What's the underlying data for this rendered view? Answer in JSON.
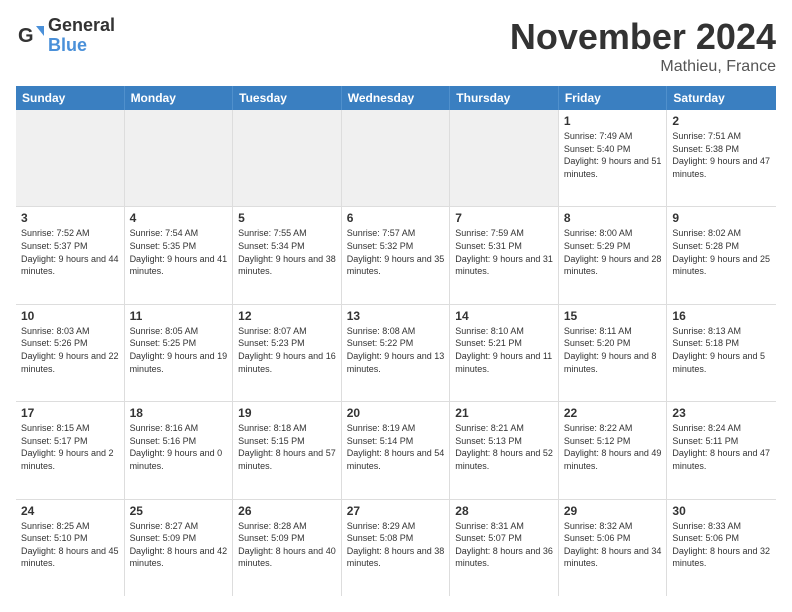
{
  "logo": {
    "general": "General",
    "blue": "Blue"
  },
  "title": "November 2024",
  "location": "Mathieu, France",
  "days_of_week": [
    "Sunday",
    "Monday",
    "Tuesday",
    "Wednesday",
    "Thursday",
    "Friday",
    "Saturday"
  ],
  "weeks": [
    [
      {
        "day": "",
        "info": ""
      },
      {
        "day": "",
        "info": ""
      },
      {
        "day": "",
        "info": ""
      },
      {
        "day": "",
        "info": ""
      },
      {
        "day": "",
        "info": ""
      },
      {
        "day": "1",
        "info": "Sunrise: 7:49 AM\nSunset: 5:40 PM\nDaylight: 9 hours and 51 minutes."
      },
      {
        "day": "2",
        "info": "Sunrise: 7:51 AM\nSunset: 5:38 PM\nDaylight: 9 hours and 47 minutes."
      }
    ],
    [
      {
        "day": "3",
        "info": "Sunrise: 7:52 AM\nSunset: 5:37 PM\nDaylight: 9 hours and 44 minutes."
      },
      {
        "day": "4",
        "info": "Sunrise: 7:54 AM\nSunset: 5:35 PM\nDaylight: 9 hours and 41 minutes."
      },
      {
        "day": "5",
        "info": "Sunrise: 7:55 AM\nSunset: 5:34 PM\nDaylight: 9 hours and 38 minutes."
      },
      {
        "day": "6",
        "info": "Sunrise: 7:57 AM\nSunset: 5:32 PM\nDaylight: 9 hours and 35 minutes."
      },
      {
        "day": "7",
        "info": "Sunrise: 7:59 AM\nSunset: 5:31 PM\nDaylight: 9 hours and 31 minutes."
      },
      {
        "day": "8",
        "info": "Sunrise: 8:00 AM\nSunset: 5:29 PM\nDaylight: 9 hours and 28 minutes."
      },
      {
        "day": "9",
        "info": "Sunrise: 8:02 AM\nSunset: 5:28 PM\nDaylight: 9 hours and 25 minutes."
      }
    ],
    [
      {
        "day": "10",
        "info": "Sunrise: 8:03 AM\nSunset: 5:26 PM\nDaylight: 9 hours and 22 minutes."
      },
      {
        "day": "11",
        "info": "Sunrise: 8:05 AM\nSunset: 5:25 PM\nDaylight: 9 hours and 19 minutes."
      },
      {
        "day": "12",
        "info": "Sunrise: 8:07 AM\nSunset: 5:23 PM\nDaylight: 9 hours and 16 minutes."
      },
      {
        "day": "13",
        "info": "Sunrise: 8:08 AM\nSunset: 5:22 PM\nDaylight: 9 hours and 13 minutes."
      },
      {
        "day": "14",
        "info": "Sunrise: 8:10 AM\nSunset: 5:21 PM\nDaylight: 9 hours and 11 minutes."
      },
      {
        "day": "15",
        "info": "Sunrise: 8:11 AM\nSunset: 5:20 PM\nDaylight: 9 hours and 8 minutes."
      },
      {
        "day": "16",
        "info": "Sunrise: 8:13 AM\nSunset: 5:18 PM\nDaylight: 9 hours and 5 minutes."
      }
    ],
    [
      {
        "day": "17",
        "info": "Sunrise: 8:15 AM\nSunset: 5:17 PM\nDaylight: 9 hours and 2 minutes."
      },
      {
        "day": "18",
        "info": "Sunrise: 8:16 AM\nSunset: 5:16 PM\nDaylight: 9 hours and 0 minutes."
      },
      {
        "day": "19",
        "info": "Sunrise: 8:18 AM\nSunset: 5:15 PM\nDaylight: 8 hours and 57 minutes."
      },
      {
        "day": "20",
        "info": "Sunrise: 8:19 AM\nSunset: 5:14 PM\nDaylight: 8 hours and 54 minutes."
      },
      {
        "day": "21",
        "info": "Sunrise: 8:21 AM\nSunset: 5:13 PM\nDaylight: 8 hours and 52 minutes."
      },
      {
        "day": "22",
        "info": "Sunrise: 8:22 AM\nSunset: 5:12 PM\nDaylight: 8 hours and 49 minutes."
      },
      {
        "day": "23",
        "info": "Sunrise: 8:24 AM\nSunset: 5:11 PM\nDaylight: 8 hours and 47 minutes."
      }
    ],
    [
      {
        "day": "24",
        "info": "Sunrise: 8:25 AM\nSunset: 5:10 PM\nDaylight: 8 hours and 45 minutes."
      },
      {
        "day": "25",
        "info": "Sunrise: 8:27 AM\nSunset: 5:09 PM\nDaylight: 8 hours and 42 minutes."
      },
      {
        "day": "26",
        "info": "Sunrise: 8:28 AM\nSunset: 5:09 PM\nDaylight: 8 hours and 40 minutes."
      },
      {
        "day": "27",
        "info": "Sunrise: 8:29 AM\nSunset: 5:08 PM\nDaylight: 8 hours and 38 minutes."
      },
      {
        "day": "28",
        "info": "Sunrise: 8:31 AM\nSunset: 5:07 PM\nDaylight: 8 hours and 36 minutes."
      },
      {
        "day": "29",
        "info": "Sunrise: 8:32 AM\nSunset: 5:06 PM\nDaylight: 8 hours and 34 minutes."
      },
      {
        "day": "30",
        "info": "Sunrise: 8:33 AM\nSunset: 5:06 PM\nDaylight: 8 hours and 32 minutes."
      }
    ]
  ]
}
